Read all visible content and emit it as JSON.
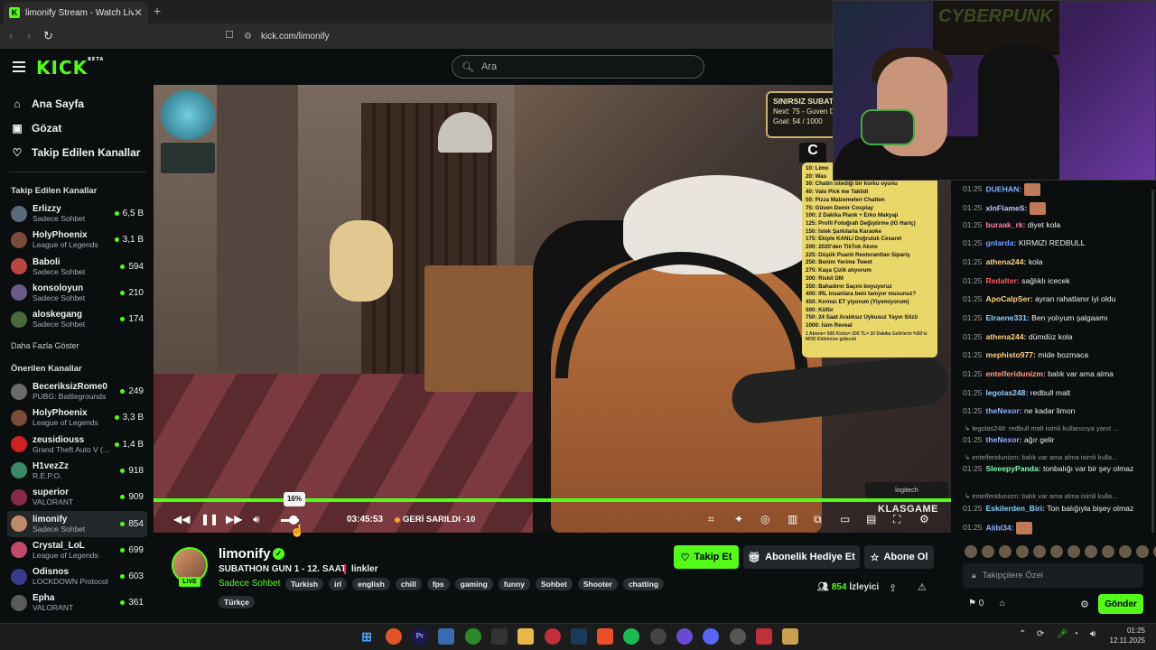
{
  "browser": {
    "tab_title": "limonify Stream - Watch Live",
    "tab_favicon": "K",
    "new_tab": "+",
    "url": "kick.com/limonify"
  },
  "header": {
    "logo": "KICK",
    "logo_badge": "BETA",
    "search_placeholder": "Ara"
  },
  "sidebar": {
    "nav": [
      {
        "label": "Ana Sayfa",
        "icon": "home-icon"
      },
      {
        "label": "Gözat",
        "icon": "browse-icon"
      },
      {
        "label": "Takip Edilen Kanallar",
        "icon": "heart-icon"
      }
    ],
    "followed_title": "Takip Edilen Kanallar",
    "followed": [
      {
        "name": "Erlizzy",
        "game": "Sadece Sohbet",
        "viewers": "6,5 B",
        "color": "#5a6a7a"
      },
      {
        "name": "HolyPhoenix",
        "game": "League of Legends",
        "viewers": "3,1 B",
        "color": "#7a4a3a"
      },
      {
        "name": "Baboli",
        "game": "Sadece Sohbet",
        "viewers": "594",
        "color": "#b44"
      },
      {
        "name": "konsoloyun",
        "game": "Sadece Sohbet",
        "viewers": "210",
        "color": "#6a5a8a"
      },
      {
        "name": "aloskegang",
        "game": "Sadece Sohbet",
        "viewers": "174",
        "color": "#4a6a3a"
      }
    ],
    "show_more": "Daha Fazla Göster",
    "recommended_title": "Önerilen Kanallar",
    "recommended": [
      {
        "name": "BeceriksizRome0",
        "game": "PUBG: Battlegrounds",
        "viewers": "249",
        "color": "#6a6a6a"
      },
      {
        "name": "HolyPhoenix",
        "game": "League of Legends",
        "viewers": "3,3 B",
        "color": "#7a4a3a"
      },
      {
        "name": "zeusidiouss",
        "game": "Grand Theft Auto V (...",
        "viewers": "1,4 B",
        "color": "#c22"
      },
      {
        "name": "H1vezZz",
        "game": "R.E.P.O.",
        "viewers": "918",
        "color": "#3a8a6a"
      },
      {
        "name": "superior",
        "game": "VALORANT",
        "viewers": "909",
        "color": "#8a2a4a"
      },
      {
        "name": "limonify",
        "game": "Sadece Sohbet",
        "viewers": "854",
        "color": "#c08a6a",
        "active": true
      },
      {
        "name": "Crystal_LoL",
        "game": "League of Legends",
        "viewers": "699",
        "color": "#c04a6a"
      },
      {
        "name": "Odisnos",
        "game": "LOCKDOWN Protocol",
        "viewers": "603",
        "color": "#3a3a8a"
      },
      {
        "name": "Epha",
        "game": "VALORANT",
        "viewers": "361",
        "color": "#5a5a5a"
      }
    ]
  },
  "video_overlay": {
    "goal_title": "SINIRSIZ SUBATH",
    "goal_next": "Next: 75 - Guven D",
    "goal_progress": "Goal: 54 / 1000",
    "goal_letter": "C",
    "goal_list": [
      "10: Limo",
      "20: Was",
      "30: Chatin istediği bir korku oyunu",
      "40: Valo Pick me Taklidi",
      "50: Pizza Malzemeleri Chatten",
      "75: Güven Demir Cosplay",
      "100: 2 Dakika Plank + Erko Makyajı",
      "125: Profil Fotoğrafı Değiştirme (IG Hariç)",
      "150: İstek Şarkılarla Karaoke",
      "175: Ekiple KANLI Doğruluk Cesaret",
      "200: 2020'den TikTok Akımı",
      "225: Düşük Puanlı Restoranttan Sipariş",
      "250: Benim Yerime Tweet",
      "275: Kaşa Çizik atıyorum",
      "300: Riskli DM",
      "350: Bahadırın Saçını boyuyoruz",
      "400: IRL insanlara beni tanıyor musunuz?",
      "450: Kırmızı ET yiyorum (Yiyemiyorum)",
      "500: Küfür",
      "750: 24 Saat Aralıksız Uykusuz Yayın Sözü",
      "1000: İsim Reveal"
    ],
    "goal_footer": "1 Abone= 500 Kicks= 200 TL= 10 Dakika Gelirlerin %50'si MOD Ekibimize gidecek",
    "logitech": "logitech",
    "sponsor": "KLASGAME",
    "webcam_poster": "CYBERPUNK"
  },
  "player": {
    "volume_tooltip": "16%",
    "volume_level_percent": 16,
    "time": "03:45:53",
    "behind_label": "GERİ SARILDI -10"
  },
  "stream_info": {
    "live_badge": "LIVE",
    "channel": "limonify",
    "title": "SUBATHON GUN 1 - 12. SAAT",
    "links": "linkler",
    "category": "Sadece Sohbet",
    "tags": [
      "Turkish",
      "irl",
      "english",
      "chill",
      "fps",
      "gaming",
      "funny",
      "Sohbet",
      "Shooter",
      "chatting"
    ],
    "tag_extra": "Türkçe",
    "follow": "Takip Et",
    "gift": "Abonelik Hediye Et",
    "subscribe": "Abone Ol",
    "viewers": "854",
    "viewers_label": "İzleyici"
  },
  "chat": {
    "messages": [
      {
        "time": "01:25",
        "user": "DUEHAN:",
        "color": "#7fb3ff",
        "text": "",
        "emote": true
      },
      {
        "time": "01:25",
        "user": "xlnFlameS:",
        "color": "#c9c9ff",
        "text": "",
        "emote": true
      },
      {
        "time": "01:25",
        "user": "buraak_rk:",
        "color": "#ff7fa0",
        "text": "diyet kola"
      },
      {
        "time": "01:25",
        "user": "gnlarda:",
        "color": "#6fa0ff",
        "text": "KIRMIZI REDBULL"
      },
      {
        "time": "01:25",
        "user": "athena244:",
        "color": "#ffd37f",
        "text": "kola"
      },
      {
        "time": "01:25",
        "user": "Redalter:",
        "color": "#ff5a5a",
        "text": "sağlıklı icecek"
      },
      {
        "time": "01:25",
        "user": "ApoCalpSer:",
        "color": "#ffd37f",
        "text": "ayran rahatlanır iyi oldu"
      },
      {
        "time": "01:25",
        "user": "Elraene331:",
        "color": "#8fd0ff",
        "text": "Ben yolıyum şalgaamı"
      },
      {
        "time": "01:25",
        "user": "athena244:",
        "color": "#ffd37f",
        "text": "dümdüz kola"
      },
      {
        "time": "01:25",
        "user": "mephisto977:",
        "color": "#ffd37f",
        "text": "mide bozmaca"
      },
      {
        "time": "01:25",
        "user": "entelferidunizm:",
        "color": "#ff9f7f",
        "text": "balık var ama alma"
      },
      {
        "time": "01:25",
        "user": "legolas248:",
        "color": "#8fd0ff",
        "text": "redbull malt"
      },
      {
        "time": "01:25",
        "user": "theNexor:",
        "color": "#8fb3ff",
        "text": "ne kadar limon"
      },
      {
        "reply": "legolas248: redbull malt isimli kullanıcıya yanıt ..."
      },
      {
        "time": "01:25",
        "user": "theNexor:",
        "color": "#8fb3ff",
        "text": "ağır gelir"
      },
      {
        "reply": "entelferidunizm: balık var ama alma isimli kulla..."
      },
      {
        "time": "01:25",
        "user": "SleeepyPanda:",
        "color": "#7fffb3",
        "text": "tonbalığı var bir şey olmaz"
      },
      {
        "reply": "entelferidunizm: balık var ama alma isimli kulla..."
      },
      {
        "time": "01:25",
        "user": "Eskilerden_Biri:",
        "color": "#7fd3ff",
        "text": "Ton balığıyla bişey olmaz"
      },
      {
        "time": "01:25",
        "user": "Alibl34:",
        "color": "#8fb3ff",
        "text": "",
        "emote": true
      }
    ],
    "input_placeholder": "Takipçilere Özel",
    "kicks": "0",
    "send": "Gönder"
  },
  "taskbar": {
    "clock_time": "01:25",
    "clock_date": "12.11.2025"
  },
  "colors": {
    "accent": "#53fc18",
    "bg": "#0b0e0f"
  }
}
